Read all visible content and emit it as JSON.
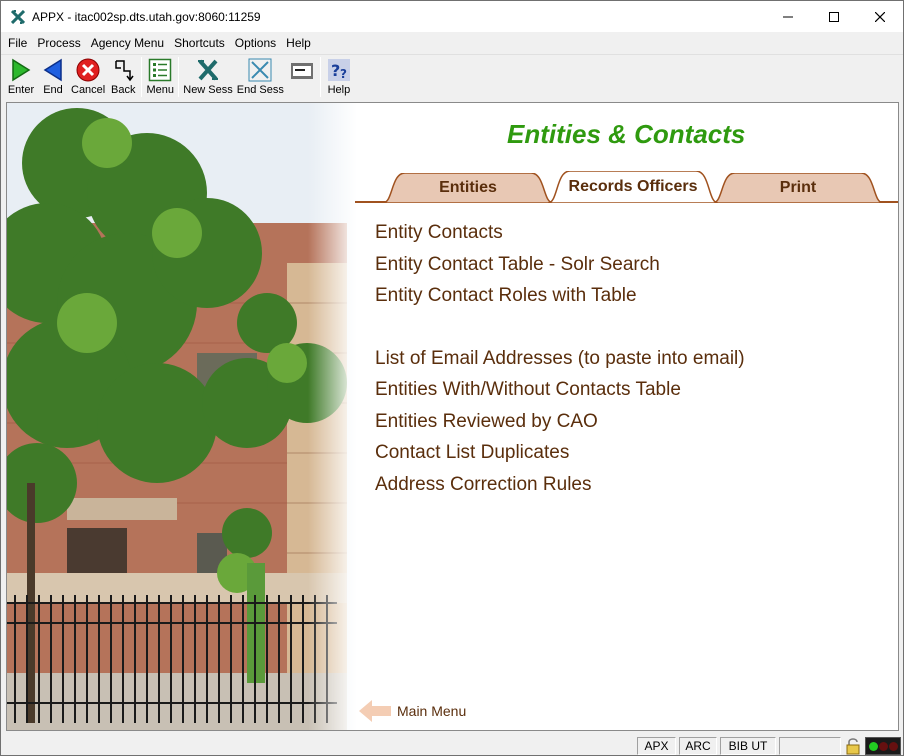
{
  "window": {
    "title": "APPX - itac002sp.dts.utah.gov:8060:11259"
  },
  "menubar": {
    "items": [
      "File",
      "Process",
      "Agency Menu",
      "Shortcuts",
      "Options",
      "Help"
    ]
  },
  "toolbar": {
    "enter": "Enter",
    "end": "End",
    "cancel": "Cancel",
    "back": "Back",
    "menu": "Menu",
    "new_sess": "New Sess",
    "end_sess": "End Sess",
    "help": "Help"
  },
  "page": {
    "heading": "Entities & Contacts",
    "tabs": [
      {
        "label": "Entities",
        "active": false
      },
      {
        "label": "Records Officers",
        "active": true
      },
      {
        "label": "Print",
        "active": false
      }
    ],
    "links_group1": [
      "Entity Contacts",
      "Entity Contact Table - Solr Search",
      "Entity Contact Roles with Table"
    ],
    "links_group2": [
      "List of Email Addresses (to paste into email)",
      "Entities With/Without Contacts Table",
      "Entities Reviewed by CAO",
      "Contact List Duplicates",
      "Address Correction Rules"
    ],
    "main_menu_label": "Main Menu"
  },
  "statusbar": {
    "cells": [
      "APX",
      "ARC",
      "BIB UT"
    ]
  },
  "colors": {
    "heading": "#2f9a0f",
    "link": "#5a2e0c",
    "tab_fill": "#e8c8b4",
    "tab_border": "#a0521f"
  }
}
